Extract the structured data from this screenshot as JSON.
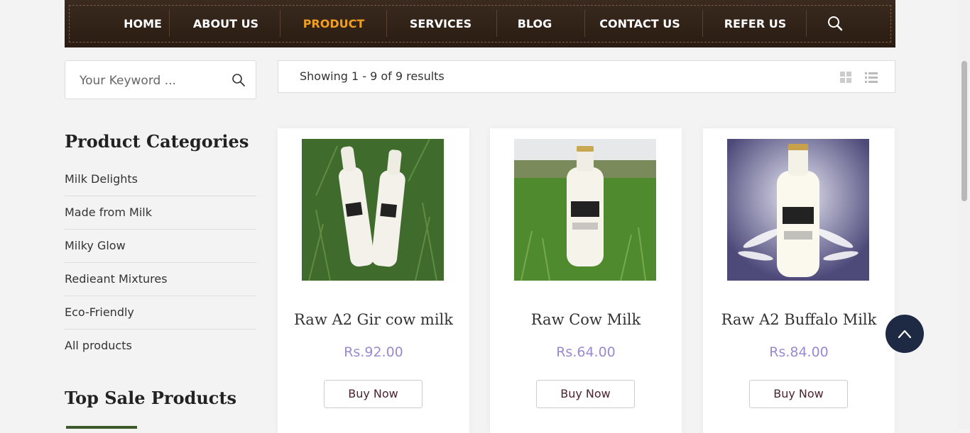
{
  "nav": {
    "items": [
      {
        "label": "HOME",
        "active": false
      },
      {
        "label": "ABOUT US",
        "active": false
      },
      {
        "label": "PRODUCT",
        "active": true
      },
      {
        "label": "SERVICES",
        "active": false
      },
      {
        "label": "BLOG",
        "active": false
      },
      {
        "label": "CONTACT US",
        "active": false
      },
      {
        "label": "REFER US",
        "active": false
      }
    ],
    "search_icon": "search-icon",
    "active_color": "#f0a020"
  },
  "search": {
    "placeholder": "Your Keyword ..."
  },
  "sidebar": {
    "categories_title": "Product Categories",
    "categories": [
      "Milk Delights",
      "Made from Milk",
      "Milky Glow",
      "Redieant Mixtures",
      "Eco-Friendly",
      "All products"
    ],
    "top_sale_title": "Top Sale Products"
  },
  "results": {
    "text": "Showing 1 - 9 of 9 results"
  },
  "products": [
    {
      "name": "Raw A2 Gir cow milk",
      "price": "Rs.92.00",
      "button": "Buy Now"
    },
    {
      "name": "Raw Cow Milk",
      "price": "Rs.64.00",
      "button": "Buy Now"
    },
    {
      "name": "Raw A2 Buffalo Milk",
      "price": "Rs.84.00",
      "button": "Buy Now"
    }
  ],
  "colors": {
    "price": "#9a8ad0",
    "nav_bg": "#3a2a1f",
    "back_top": "#1e2a44"
  }
}
